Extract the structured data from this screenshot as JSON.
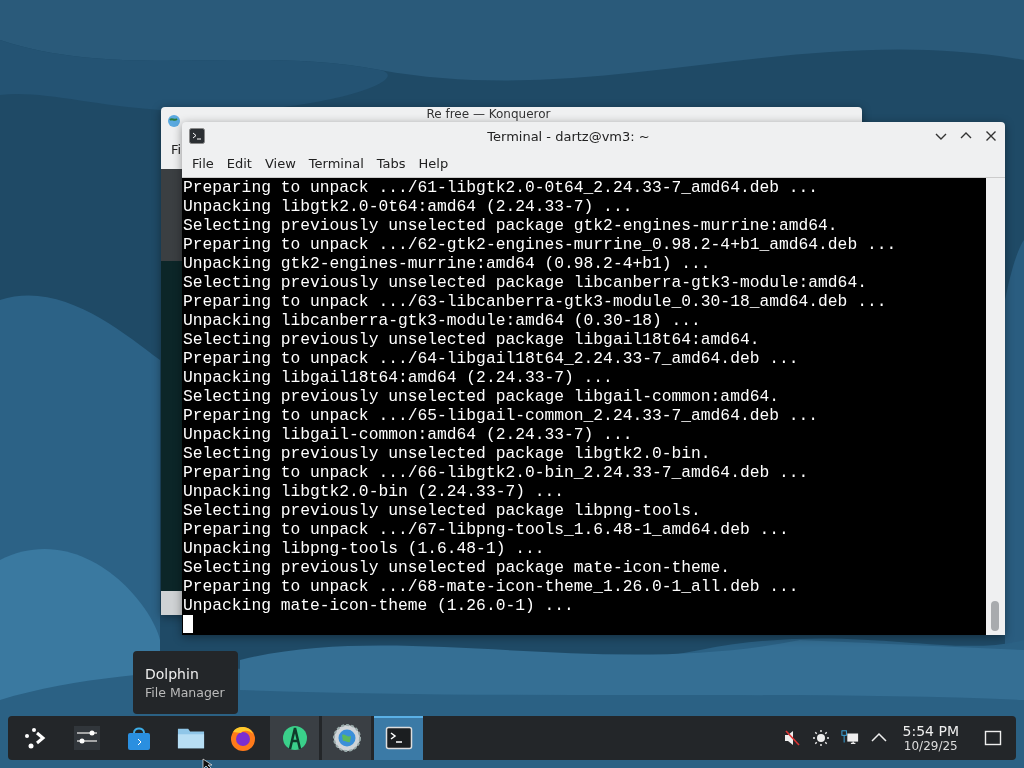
{
  "background_window": {
    "title": [
      "Re free",
      "—",
      "Konqueror"
    ],
    "menu_fragment": "Fi"
  },
  "terminal": {
    "title": "Terminal - dartz@vm3: ~",
    "menu": [
      "File",
      "Edit",
      "View",
      "Terminal",
      "Tabs",
      "Help"
    ],
    "lines": [
      "Preparing to unpack .../61-libgtk2.0-0t64_2.24.33-7_amd64.deb ...",
      "Unpacking libgtk2.0-0t64:amd64 (2.24.33-7) ...",
      "Selecting previously unselected package gtk2-engines-murrine:amd64.",
      "Preparing to unpack .../62-gtk2-engines-murrine_0.98.2-4+b1_amd64.deb ...",
      "Unpacking gtk2-engines-murrine:amd64 (0.98.2-4+b1) ...",
      "Selecting previously unselected package libcanberra-gtk3-module:amd64.",
      "Preparing to unpack .../63-libcanberra-gtk3-module_0.30-18_amd64.deb ...",
      "Unpacking libcanberra-gtk3-module:amd64 (0.30-18) ...",
      "Selecting previously unselected package libgail18t64:amd64.",
      "Preparing to unpack .../64-libgail18t64_2.24.33-7_amd64.deb ...",
      "Unpacking libgail18t64:amd64 (2.24.33-7) ...",
      "Selecting previously unselected package libgail-common:amd64.",
      "Preparing to unpack .../65-libgail-common_2.24.33-7_amd64.deb ...",
      "Unpacking libgail-common:amd64 (2.24.33-7) ...",
      "Selecting previously unselected package libgtk2.0-bin.",
      "Preparing to unpack .../66-libgtk2.0-bin_2.24.33-7_amd64.deb ...",
      "Unpacking libgtk2.0-bin (2.24.33-7) ...",
      "Selecting previously unselected package libpng-tools.",
      "Preparing to unpack .../67-libpng-tools_1.6.48-1_amd64.deb ...",
      "Unpacking libpng-tools (1.6.48-1) ...",
      "Selecting previously unselected package mate-icon-theme.",
      "Preparing to unpack .../68-mate-icon-theme_1.26.0-1_all.deb ...",
      "Unpacking mate-icon-theme (1.26.0-1) ..."
    ]
  },
  "tooltip": {
    "title": "Dolphin",
    "subtitle": "File Manager"
  },
  "taskbar": {
    "apps": [
      {
        "kind": "launcher",
        "running": false,
        "selected": false
      },
      {
        "kind": "sliders",
        "running": false,
        "selected": false
      },
      {
        "kind": "store",
        "running": false,
        "selected": false
      },
      {
        "kind": "folder",
        "running": false,
        "selected": false
      },
      {
        "kind": "browser",
        "running": false,
        "selected": false
      },
      {
        "kind": "letter",
        "running": true,
        "selected": false
      },
      {
        "kind": "globe",
        "running": true,
        "selected": false
      },
      {
        "kind": "terminal",
        "running": true,
        "selected": true
      }
    ],
    "tray": {
      "muted": true,
      "time": "5:54 PM",
      "date": "10/29/25"
    }
  }
}
